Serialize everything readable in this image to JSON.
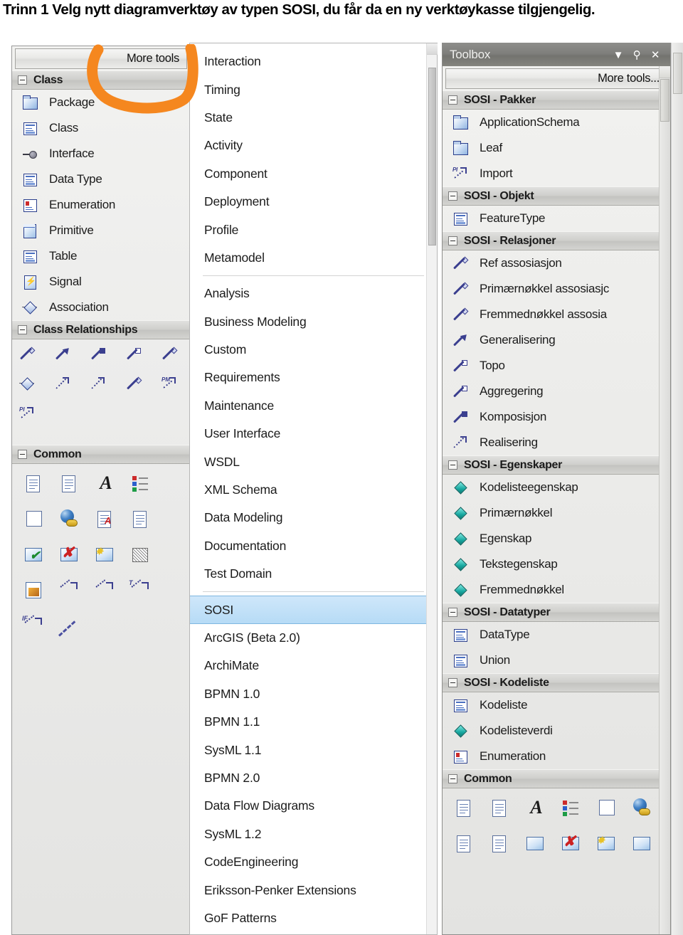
{
  "caption": "Trinn 1  Velg nytt diagramverktøy av typen SOSI, du får da en ny verktøykasse tilgjengelig.",
  "annotation": {
    "shape": "orange-u-highlight",
    "color": "#F5871F",
    "target": "more-tools-button"
  },
  "left_toolbox": {
    "more_tools_label": "More tools",
    "sections": [
      {
        "title": "Class",
        "items": [
          {
            "label": "Package",
            "icon": "package-icon"
          },
          {
            "label": "Class",
            "icon": "class-icon"
          },
          {
            "label": "Interface",
            "icon": "interface-icon"
          },
          {
            "label": "Data Type",
            "icon": "datatype-icon"
          },
          {
            "label": "Enumeration",
            "icon": "enumeration-icon"
          },
          {
            "label": "Primitive",
            "icon": "primitive-icon"
          },
          {
            "label": "Table",
            "icon": "table-icon"
          },
          {
            "label": "Signal",
            "icon": "signal-icon"
          },
          {
            "label": "Association",
            "icon": "association-icon"
          }
        ]
      },
      {
        "title": "Class Relationships",
        "icon_grid": [
          "associate-icon",
          "generalize-icon",
          "compose-icon",
          "aggregate-icon",
          "nest-icon",
          "assembly-icon",
          "realize-icon",
          "dependency-icon",
          "trace-icon",
          "package-merge-icon",
          "package-import-icon"
        ]
      },
      {
        "title": "Common",
        "icon_grid": [
          "note-icon",
          "note-link-icon",
          "text-icon",
          "legend-icon",
          "diagram-note-icon",
          "web-hyperlink-icon",
          "constraint-icon",
          "document-icon",
          "checklist-icon",
          "delete-image-icon",
          "new-diagram-icon",
          "screen-icon",
          "image-icon",
          "dependency-icon",
          "realize-icon",
          "trace-icon",
          "information-flow-icon",
          "dashed-line-icon"
        ]
      }
    ]
  },
  "diagram_menu": {
    "groups": [
      {
        "items": [
          "Interaction",
          "Timing",
          "State",
          "Activity",
          "Component",
          "Deployment",
          "Profile",
          "Metamodel"
        ]
      },
      {
        "items": [
          "Analysis",
          "Business Modeling",
          "Custom",
          "Requirements",
          "Maintenance",
          "User Interface",
          "WSDL",
          "XML Schema",
          "Data Modeling",
          "Documentation",
          "Test Domain"
        ]
      },
      {
        "items": [
          "SOSI",
          "ArcGIS (Beta 2.0)",
          "ArchiMate",
          "BPMN 1.0",
          "BPMN 1.1",
          "SysML 1.1",
          "BPMN 2.0",
          "Data Flow Diagrams",
          "SysML 1.2",
          "CodeEngineering",
          "Eriksson-Penker Extensions",
          "GoF Patterns"
        ]
      }
    ],
    "selected": "SOSI"
  },
  "toolbox_panel": {
    "title": "Toolbox",
    "title_buttons": [
      {
        "name": "chevron-down-icon",
        "glyph": "▼"
      },
      {
        "name": "pin-icon",
        "glyph": "⚲"
      },
      {
        "name": "close-icon",
        "glyph": "✕"
      }
    ],
    "more_tools_label": "More tools...",
    "sections": [
      {
        "title": "SOSI - Pakker",
        "items": [
          {
            "label": "ApplicationSchema",
            "icon": "package-icon"
          },
          {
            "label": "Leaf",
            "icon": "package-icon"
          },
          {
            "label": "Import",
            "icon": "package-import-icon"
          }
        ]
      },
      {
        "title": "SOSI - Objekt",
        "items": [
          {
            "label": "FeatureType",
            "icon": "class-icon"
          }
        ]
      },
      {
        "title": "SOSI - Relasjoner",
        "items": [
          {
            "label": "Ref assosiasjon",
            "icon": "association-line-icon"
          },
          {
            "label": "Primærnøkkel assosiasjc",
            "icon": "association-line-icon"
          },
          {
            "label": "Fremmednøkkel assosia",
            "icon": "association-line-icon"
          },
          {
            "label": "Generalisering",
            "icon": "generalization-icon"
          },
          {
            "label": "Topo",
            "icon": "aggregation-icon"
          },
          {
            "label": "Aggregering",
            "icon": "aggregation-icon"
          },
          {
            "label": "Komposisjon",
            "icon": "composition-icon"
          },
          {
            "label": "Realisering",
            "icon": "realization-icon"
          }
        ]
      },
      {
        "title": "SOSI - Egenskaper",
        "items": [
          {
            "label": "Kodelisteegenskap",
            "icon": "attribute-diamond-icon"
          },
          {
            "label": "Primærnøkkel",
            "icon": "attribute-diamond-icon"
          },
          {
            "label": "Egenskap",
            "icon": "attribute-diamond-icon"
          },
          {
            "label": "Tekstegenskap",
            "icon": "attribute-diamond-icon"
          },
          {
            "label": "Fremmednøkkel",
            "icon": "attribute-diamond-icon"
          }
        ]
      },
      {
        "title": "SOSI - Datatyper",
        "items": [
          {
            "label": "DataType",
            "icon": "class-icon"
          },
          {
            "label": "Union",
            "icon": "class-icon"
          }
        ]
      },
      {
        "title": "SOSI - Kodeliste",
        "items": [
          {
            "label": "Kodeliste",
            "icon": "class-icon"
          },
          {
            "label": "Kodelisteverdi",
            "icon": "attribute-diamond-icon"
          },
          {
            "label": "Enumeration",
            "icon": "enumeration-icon"
          }
        ]
      },
      {
        "title": "Common",
        "icon_grid": [
          "note-icon",
          "note-link-icon",
          "text-icon",
          "legend-icon",
          "diagram-note-icon",
          "web-hyperlink-icon",
          "constraint-icon",
          "document-icon",
          "screen-icon",
          "delete-image-icon",
          "new-diagram-icon",
          "image-icon"
        ]
      }
    ]
  },
  "colors": {
    "annotation_orange": "#F5871F",
    "selection_blue": "#B6DBF6",
    "panel_gray": "#ECECEA",
    "titlebar_gray": "#7E7E7B",
    "icon_blue": "#3B3F8F",
    "attribute_teal": "#17A8A0"
  }
}
